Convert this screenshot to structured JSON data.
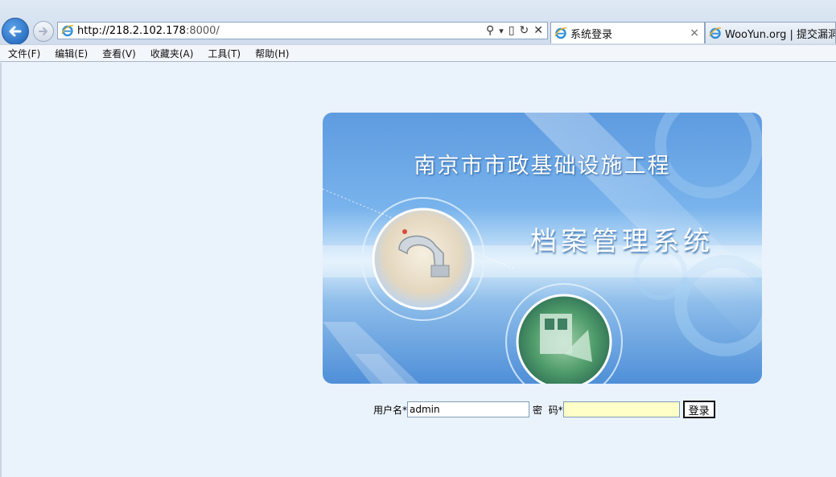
{
  "browser": {
    "url_host": "http://218.2.102.178",
    "url_rest": ":8000/",
    "tabs": [
      {
        "title": "系统登录",
        "close": "×",
        "active": true
      },
      {
        "title": "WooYun.org | 提交漏洞",
        "active": false
      }
    ],
    "menu": [
      "文件(F)",
      "编辑(E)",
      "查看(V)",
      "收藏夹(A)",
      "工具(T)",
      "帮助(H)"
    ],
    "addr_tools": {
      "search": "⚲",
      "dropdown": "▾",
      "compat": "▯",
      "refresh": "↻",
      "stop": "✕"
    }
  },
  "banner": {
    "title_line1": "南京市市政基础设施工程",
    "title_line2": "档案管理系统"
  },
  "login": {
    "username_label": "用户名*",
    "username_value": "admin",
    "password_label": "密  码*",
    "password_value": "",
    "submit_label": "登录"
  },
  "colors": {
    "page_bg": "#eaf2fb",
    "banner_blue": "#5e9be0",
    "password_bg": "#ffffc8"
  }
}
